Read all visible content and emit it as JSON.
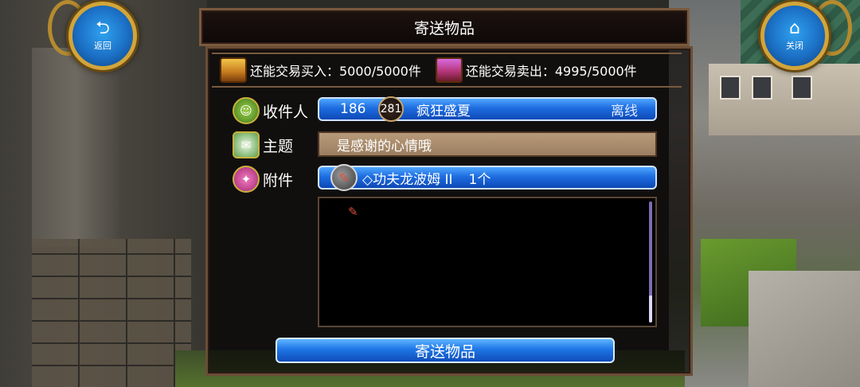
{
  "header": {
    "title": "寄送物品",
    "back_label": "返回",
    "close_label": "关闭",
    "back_icon": "back-arrow-icon",
    "close_icon": "home-icon"
  },
  "trade": {
    "buy_label": "还能交易买入：5000/5000件",
    "sell_label": "还能交易卖出：4995/5000件"
  },
  "form": {
    "recipient_label": "收件人",
    "recipient": {
      "level": "186",
      "badge": "281",
      "name": "疯狂盛夏",
      "status": "离线"
    },
    "subject_label": "主题",
    "subject_value": "是感谢的心情哦",
    "attachment_label": "附件",
    "attachment": {
      "name": "◇功夫龙波姆 II",
      "count": "1个"
    }
  },
  "send_button_label": "寄送物品",
  "colors": {
    "button_blue": "#1e6de0",
    "frame_brown": "#7a5a3e",
    "gold": "#d2a53a"
  }
}
